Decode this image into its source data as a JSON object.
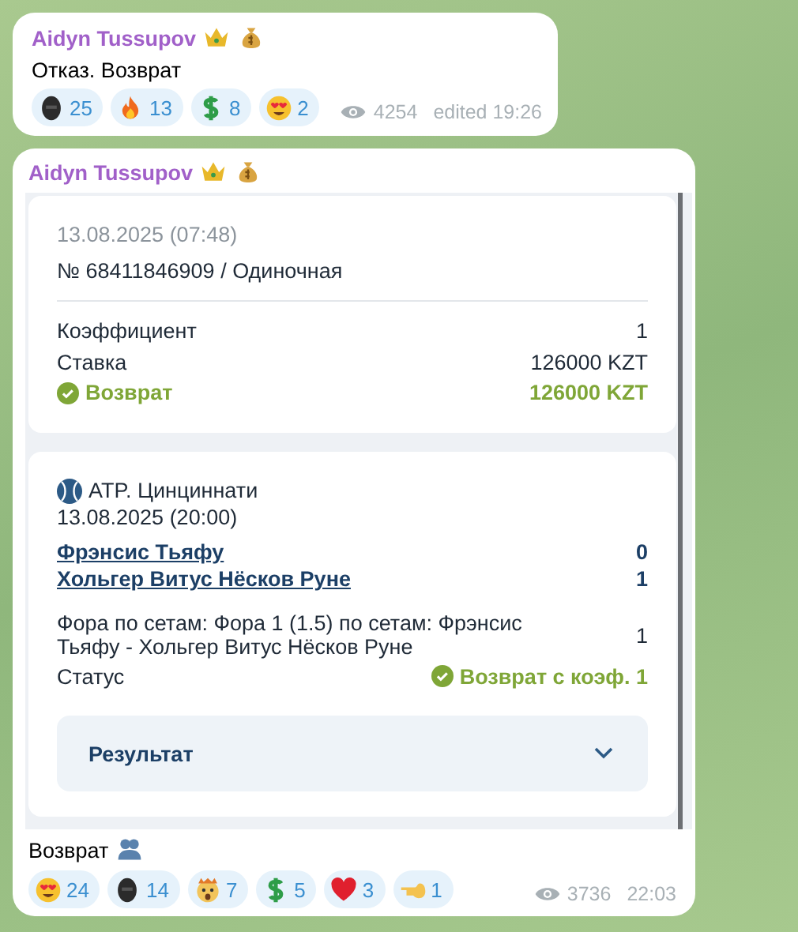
{
  "messages": [
    {
      "author": "Aidyn Tussupov",
      "text": "Отказ. Возврат",
      "views": "4254",
      "time": "edited 19:26",
      "reactions": [
        {
          "kind": "mask",
          "count": "25"
        },
        {
          "kind": "fire",
          "count": "13"
        },
        {
          "kind": "dollar",
          "count": "8"
        },
        {
          "kind": "hearteyes",
          "count": "2"
        }
      ]
    },
    {
      "author": "Aidyn Tussupov",
      "text": "Возврат",
      "views": "3736",
      "time": "22:03",
      "ticket": {
        "date": "13.08.2025 (07:48)",
        "number": "№ 68411846909 / Одиночная",
        "rows": [
          {
            "label": "Коэффициент",
            "value": "1",
            "kind": "plain"
          },
          {
            "label": "Ставка",
            "value": "126000 KZT",
            "kind": "plain"
          },
          {
            "label": "Возврат",
            "value": "126000 KZT",
            "kind": "success"
          }
        ],
        "event": {
          "league": "ATP. Цинциннати",
          "date": "13.08.2025 (20:00)",
          "players": [
            {
              "name": "Фрэнсис Тьяфу",
              "score": "0"
            },
            {
              "name": "Хольгер Витус Нёсков Руне",
              "score": "1"
            }
          ],
          "market": "Фора по сетам: Фора 1 (1.5) по сетам: Фрэнсис Тьяфу - Хольгер Витус Нёсков Руне",
          "odds": "1",
          "status_label": "Статус",
          "status": "Возврат с коэф. 1",
          "result_label": "Результат",
          "result_expanded": false
        }
      },
      "reactions": [
        {
          "kind": "hearteyes",
          "count": "24"
        },
        {
          "kind": "mask",
          "count": "14"
        },
        {
          "kind": "shock",
          "count": "7"
        },
        {
          "kind": "dollar",
          "count": "5"
        },
        {
          "kind": "heart",
          "count": "3"
        },
        {
          "kind": "hand",
          "count": "1"
        }
      ]
    }
  ]
}
